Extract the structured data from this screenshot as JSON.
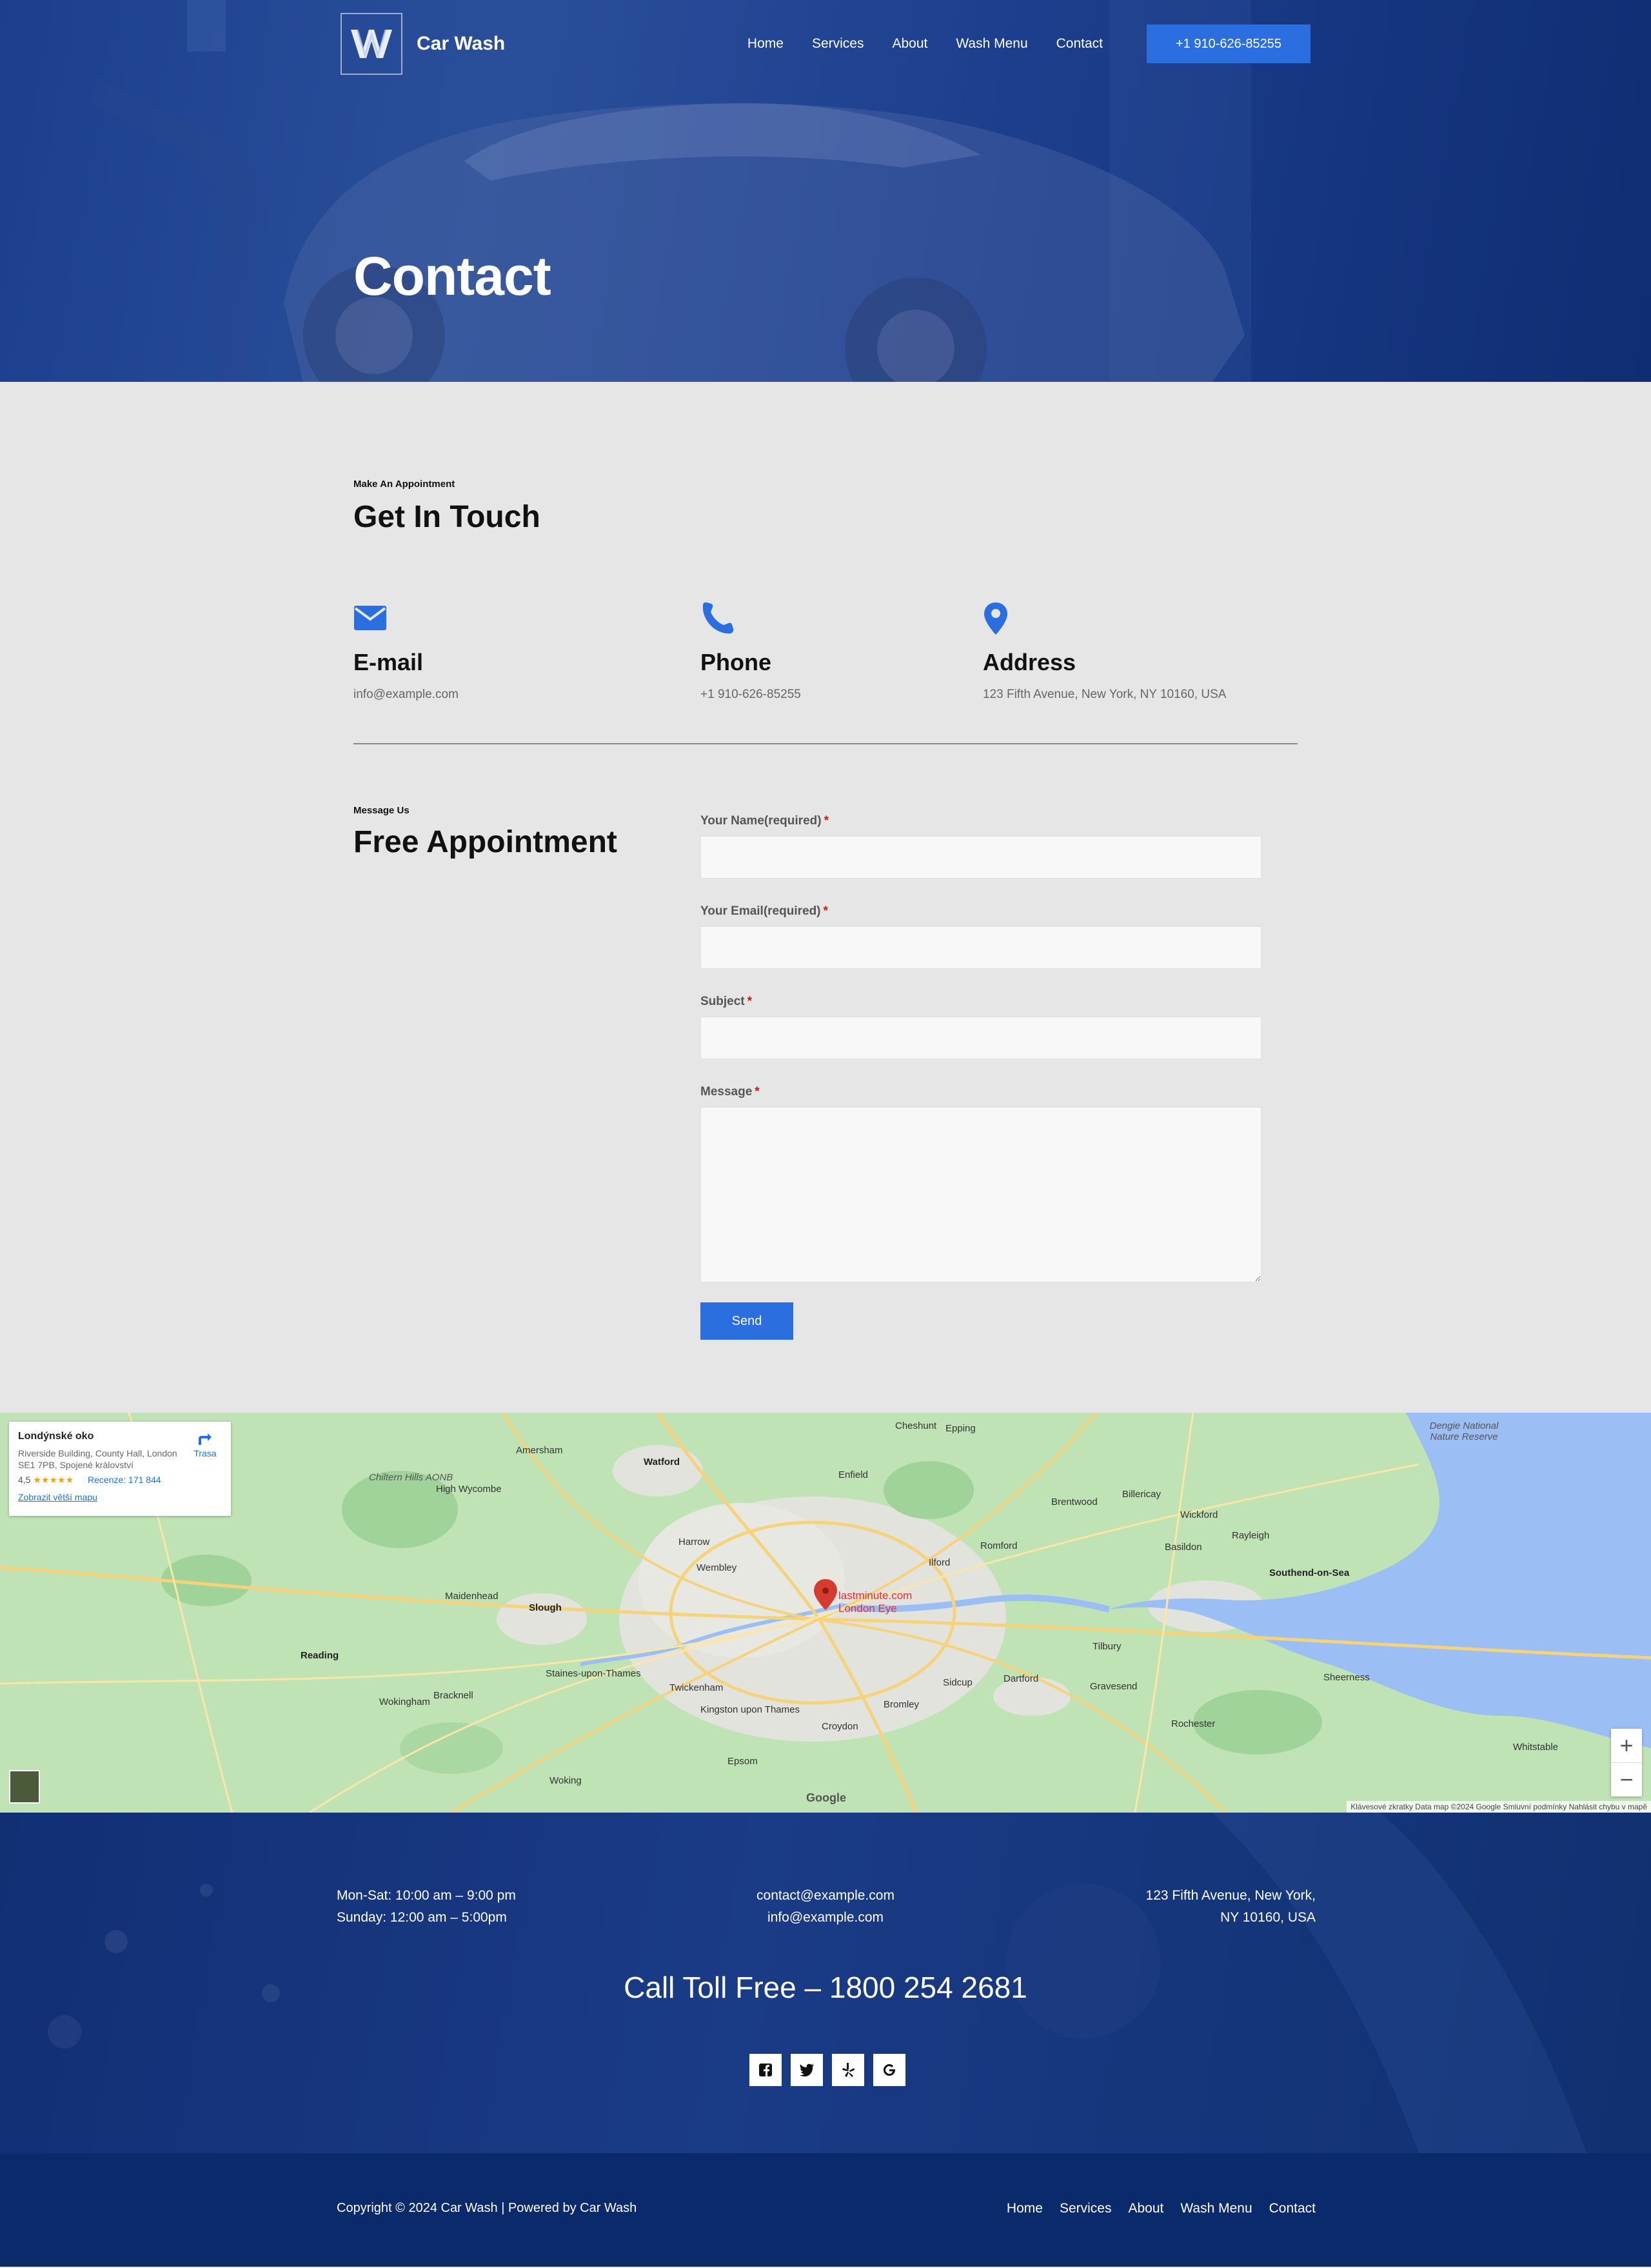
{
  "header": {
    "logo_letter": "W",
    "brand": "Car Wash",
    "nav": [
      "Home",
      "Services",
      "About",
      "Wash Menu",
      "Contact"
    ],
    "cta": "+1 910-626-85255",
    "page_title": "Contact"
  },
  "touch": {
    "kicker": "Make An Appointment",
    "title": "Get In Touch",
    "items": [
      {
        "icon": "envelope-icon",
        "label": "E-mail",
        "value": "info@example.com"
      },
      {
        "icon": "phone-icon",
        "label": "Phone",
        "value": "+1 910-626-85255"
      },
      {
        "icon": "map-pin-icon",
        "label": "Address",
        "value": "123 Fifth Avenue, New York, NY 10160, USA"
      }
    ]
  },
  "appointment": {
    "kicker": "Message Us",
    "title": "Free Appointment",
    "fields": [
      {
        "label": "Your Name(required)",
        "required_mark": "*",
        "value": ""
      },
      {
        "label": "Your Email(required)",
        "required_mark": "*",
        "value": ""
      },
      {
        "label": "Subject",
        "required_mark": "*",
        "value": ""
      },
      {
        "label": "Message",
        "required_mark": "*",
        "value": ""
      }
    ],
    "submit": "Send"
  },
  "map": {
    "place_name": "Londýnské oko",
    "place_address": "Riverside Building, County Hall, London SE1 7PB, Spojené království",
    "rating": "4,5",
    "stars": "★★★★★",
    "reviews": "Recenze: 171 844",
    "larger_map": "Zobrazit větší mapu",
    "directions": "Trasa",
    "pin_label_1": "lastminute.com",
    "pin_label_2": "London Eye",
    "google": "Google",
    "zoom_in": "+",
    "zoom_out": "−",
    "attribution": "Klávesové zkratky   Data map ©2024 Google   Smluvní podmínky   Nahlásit chybu v mapě",
    "labels": {
      "watford": "Watford",
      "slough": "Slough",
      "reading": "Reading",
      "harrow": "Harrow",
      "brentwood": "Brentwood",
      "southend": "Southend-on-Sea",
      "chelmsford": "Wickford",
      "basildon": "Basildon",
      "romford": "Romford",
      "croydon": "Croydon",
      "wembley": "Wembley",
      "richmond": "Twickenham",
      "kingston": "Kingston upon Thames",
      "dartford": "Dartford",
      "gravesend": "Gravesend",
      "rochester": "Rochester",
      "woking": "Woking",
      "bracknell": "Bracknell",
      "maidenhead": "Maidenhead",
      "high_wycombe": "High Wycombe",
      "amersham": "Amersham",
      "enfield": "Enfield",
      "epping": "Epping",
      "billericay": "Billericay",
      "sheerness": "Sheerness",
      "whitstable": "Whitstable",
      "rayleigh": "Rayleigh",
      "tilbury": "Tilbury",
      "sidcup": "Sidcup",
      "bromley": "Bromley",
      "epsom": "Epsom",
      "staines": "Staines-upon-Thames",
      "hemel": "Chiltern Hills AONB",
      "wokingham": "Wokingham",
      "hertford": "Cheshunt",
      "ilford": "Ilford",
      "dengie": "Dengie National Nature Reserve"
    }
  },
  "footer": {
    "hours_1": "Mon-Sat: 10:00 am – 9:00 pm",
    "hours_2": "Sunday: 12:00 am – 5:00pm",
    "email_1": "contact@example.com",
    "email_2": "info@example.com",
    "address_1": "123 Fifth Avenue, New York,",
    "address_2": "NY 10160, USA",
    "toll": "Call Toll Free – 1800 254 2681",
    "socials": [
      "facebook-icon",
      "twitter-icon",
      "yelp-icon",
      "google-icon"
    ],
    "copyright": "Copyright © 2024 Car Wash | Powered by Car Wash",
    "nav": [
      "Home",
      "Services",
      "About",
      "Wash Menu",
      "Contact"
    ]
  },
  "colors": {
    "accent": "#2a6ee0",
    "hero_blue": "#1b3f8e",
    "footer_blue": "#0b2a6b",
    "section_bg": "#e6e6e6"
  }
}
